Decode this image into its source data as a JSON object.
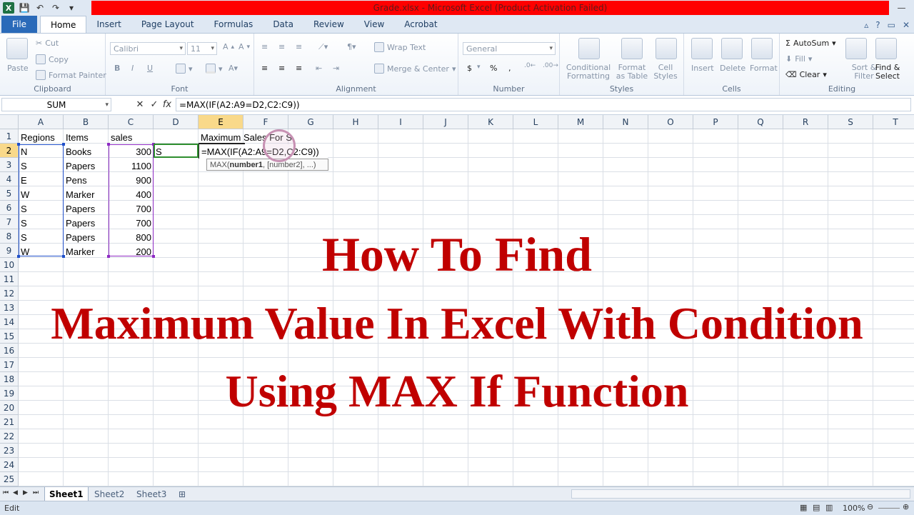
{
  "window": {
    "title": "Grade.xlsx  -  Microsoft Excel (Product Activation Failed)"
  },
  "ribbon": {
    "tabs": [
      "File",
      "Home",
      "Insert",
      "Page Layout",
      "Formulas",
      "Data",
      "Review",
      "View",
      "Acrobat"
    ],
    "active_tab": "Home",
    "clipboard": {
      "paste": "Paste",
      "cut": "Cut",
      "copy": "Copy",
      "format_painter": "Format Painter",
      "label": "Clipboard"
    },
    "font": {
      "name": "Calibri",
      "size": "11",
      "bold": "B",
      "italic": "I",
      "underline": "U",
      "label": "Font"
    },
    "alignment": {
      "wrap": "Wrap Text",
      "merge": "Merge & Center",
      "label": "Alignment"
    },
    "number": {
      "format": "General",
      "currency": "$",
      "percent": "%",
      "comma": ",",
      "label": "Number"
    },
    "styles": {
      "conditional": "Conditional Formatting",
      "format_table": "Format as Table",
      "cell_styles": "Cell Styles",
      "label": "Styles"
    },
    "cells": {
      "insert": "Insert",
      "delete": "Delete",
      "format": "Format",
      "label": "Cells"
    },
    "editing": {
      "autosum": "AutoSum",
      "fill": "Fill",
      "clear": "Clear",
      "sort": "Sort & Filter",
      "find": "Find & Select",
      "label": "Editing"
    }
  },
  "formula_bar": {
    "name_box": "SUM",
    "cancel": "✕",
    "enter": "✓",
    "fx": "fx",
    "formula": "=MAX(IF(A2:A9=D2,C2:C9))"
  },
  "columns": [
    "A",
    "B",
    "C",
    "D",
    "E",
    "F",
    "G",
    "H",
    "I",
    "J",
    "K",
    "L",
    "M",
    "N",
    "O",
    "P",
    "Q",
    "R",
    "S",
    "T"
  ],
  "rows": [
    "1",
    "2",
    "3",
    "4",
    "5",
    "6",
    "7",
    "8",
    "9",
    "10",
    "11",
    "12",
    "13",
    "14",
    "15",
    "16",
    "17",
    "18",
    "19",
    "20",
    "21",
    "22",
    "23",
    "24",
    "25"
  ],
  "selected": {
    "column": "E",
    "row": "2"
  },
  "cells": {
    "headers": {
      "regions": "Regions",
      "items": "Items",
      "sales": "sales",
      "max_label": "Maximum Sales For S"
    },
    "criteria": "S",
    "editing_formula": "=MAX(IF(A2:A9=D2,C2:C9))",
    "data": [
      {
        "region": "N",
        "item": "Books",
        "sales": "300"
      },
      {
        "region": "S",
        "item": "Papers",
        "sales": "1100"
      },
      {
        "region": "E",
        "item": "Pens",
        "sales": "900"
      },
      {
        "region": "W",
        "item": "Marker",
        "sales": "400"
      },
      {
        "region": "S",
        "item": "Papers",
        "sales": "700"
      },
      {
        "region": "S",
        "item": "Papers",
        "sales": "700"
      },
      {
        "region": "S",
        "item": "Papers",
        "sales": "800"
      },
      {
        "region": "W",
        "item": "Marker",
        "sales": "200"
      }
    ]
  },
  "tooltip": {
    "fn": "MAX(",
    "arg1": "number1",
    "rest": ", [number2], ...)"
  },
  "overlay": {
    "line1": "How To Find",
    "line2": "Maximum Value In Excel With Condition",
    "line3": "Using MAX If Function"
  },
  "sheets": [
    "Sheet1",
    "Sheet2",
    "Sheet3"
  ],
  "active_sheet": "Sheet1",
  "status": {
    "mode": "Edit",
    "zoom": "100%"
  },
  "colors": {
    "overlay_text": "#c00000",
    "title_bar": "#ff0000",
    "range_a": "#1f4fc9",
    "range_c": "#8e2ac4",
    "active_col": "#f9d98a"
  }
}
